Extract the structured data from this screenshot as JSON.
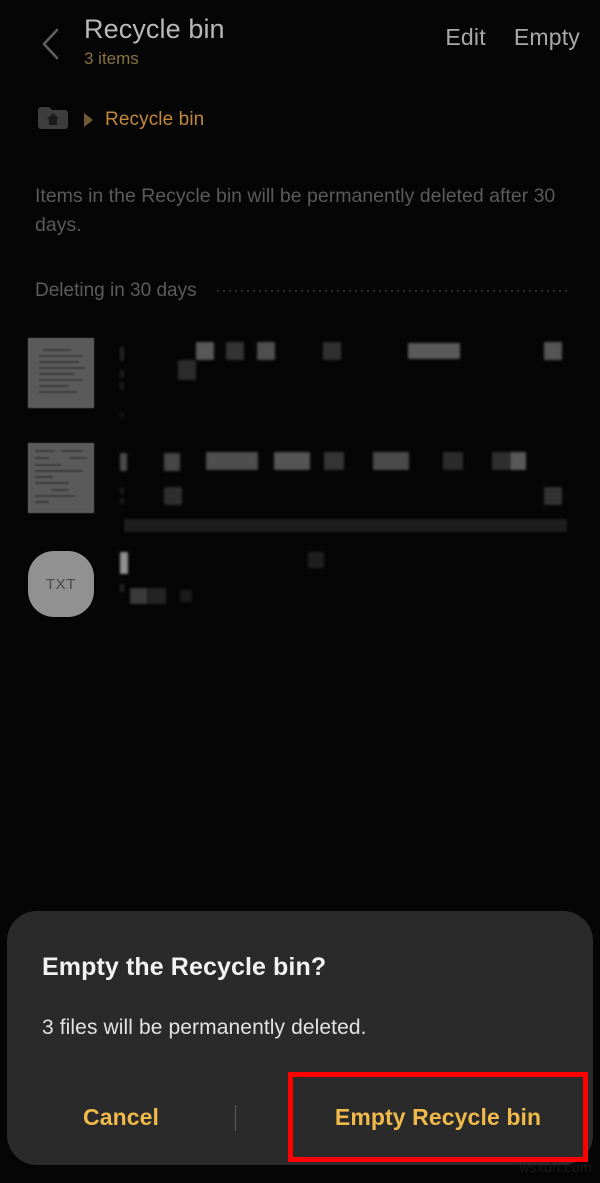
{
  "header": {
    "back_icon": "chevron-left-icon",
    "title": "Recycle bin",
    "subtitle": "3 items",
    "actions": [
      {
        "label": "Edit",
        "name": "edit-button"
      },
      {
        "label": "Empty",
        "name": "empty-button"
      }
    ]
  },
  "breadcrumb": {
    "home_icon": "home-folder-icon",
    "separator_icon": "triangle-right-icon",
    "current": "Recycle bin"
  },
  "notice": "Items in the Recycle bin will be permanently deleted after 30 days.",
  "section": {
    "title": "Deleting in 30 days"
  },
  "files": [
    {
      "thumbnail": "document-thumbnail",
      "label": ""
    },
    {
      "thumbnail": "document-thumbnail",
      "label": ""
    },
    {
      "thumbnail": "txt-file-icon",
      "label": "TXT"
    }
  ],
  "dialog": {
    "title": "Empty the Recycle bin?",
    "message": "3 files will be permanently deleted.",
    "cancel_label": "Cancel",
    "confirm_label": "Empty Recycle bin"
  },
  "annotation": {
    "highlight_color": "#ff0000",
    "target": "Empty Recycle bin"
  },
  "watermark": "wsxdn.com",
  "colors": {
    "background": "#050505",
    "accent_amber": "#f0b94b",
    "breadcrumb_amber": "#c2893c",
    "subtitle_amber": "#8a7242",
    "dialog_bg": "#2a2a2a",
    "muted_text": "#5a5a5a"
  }
}
